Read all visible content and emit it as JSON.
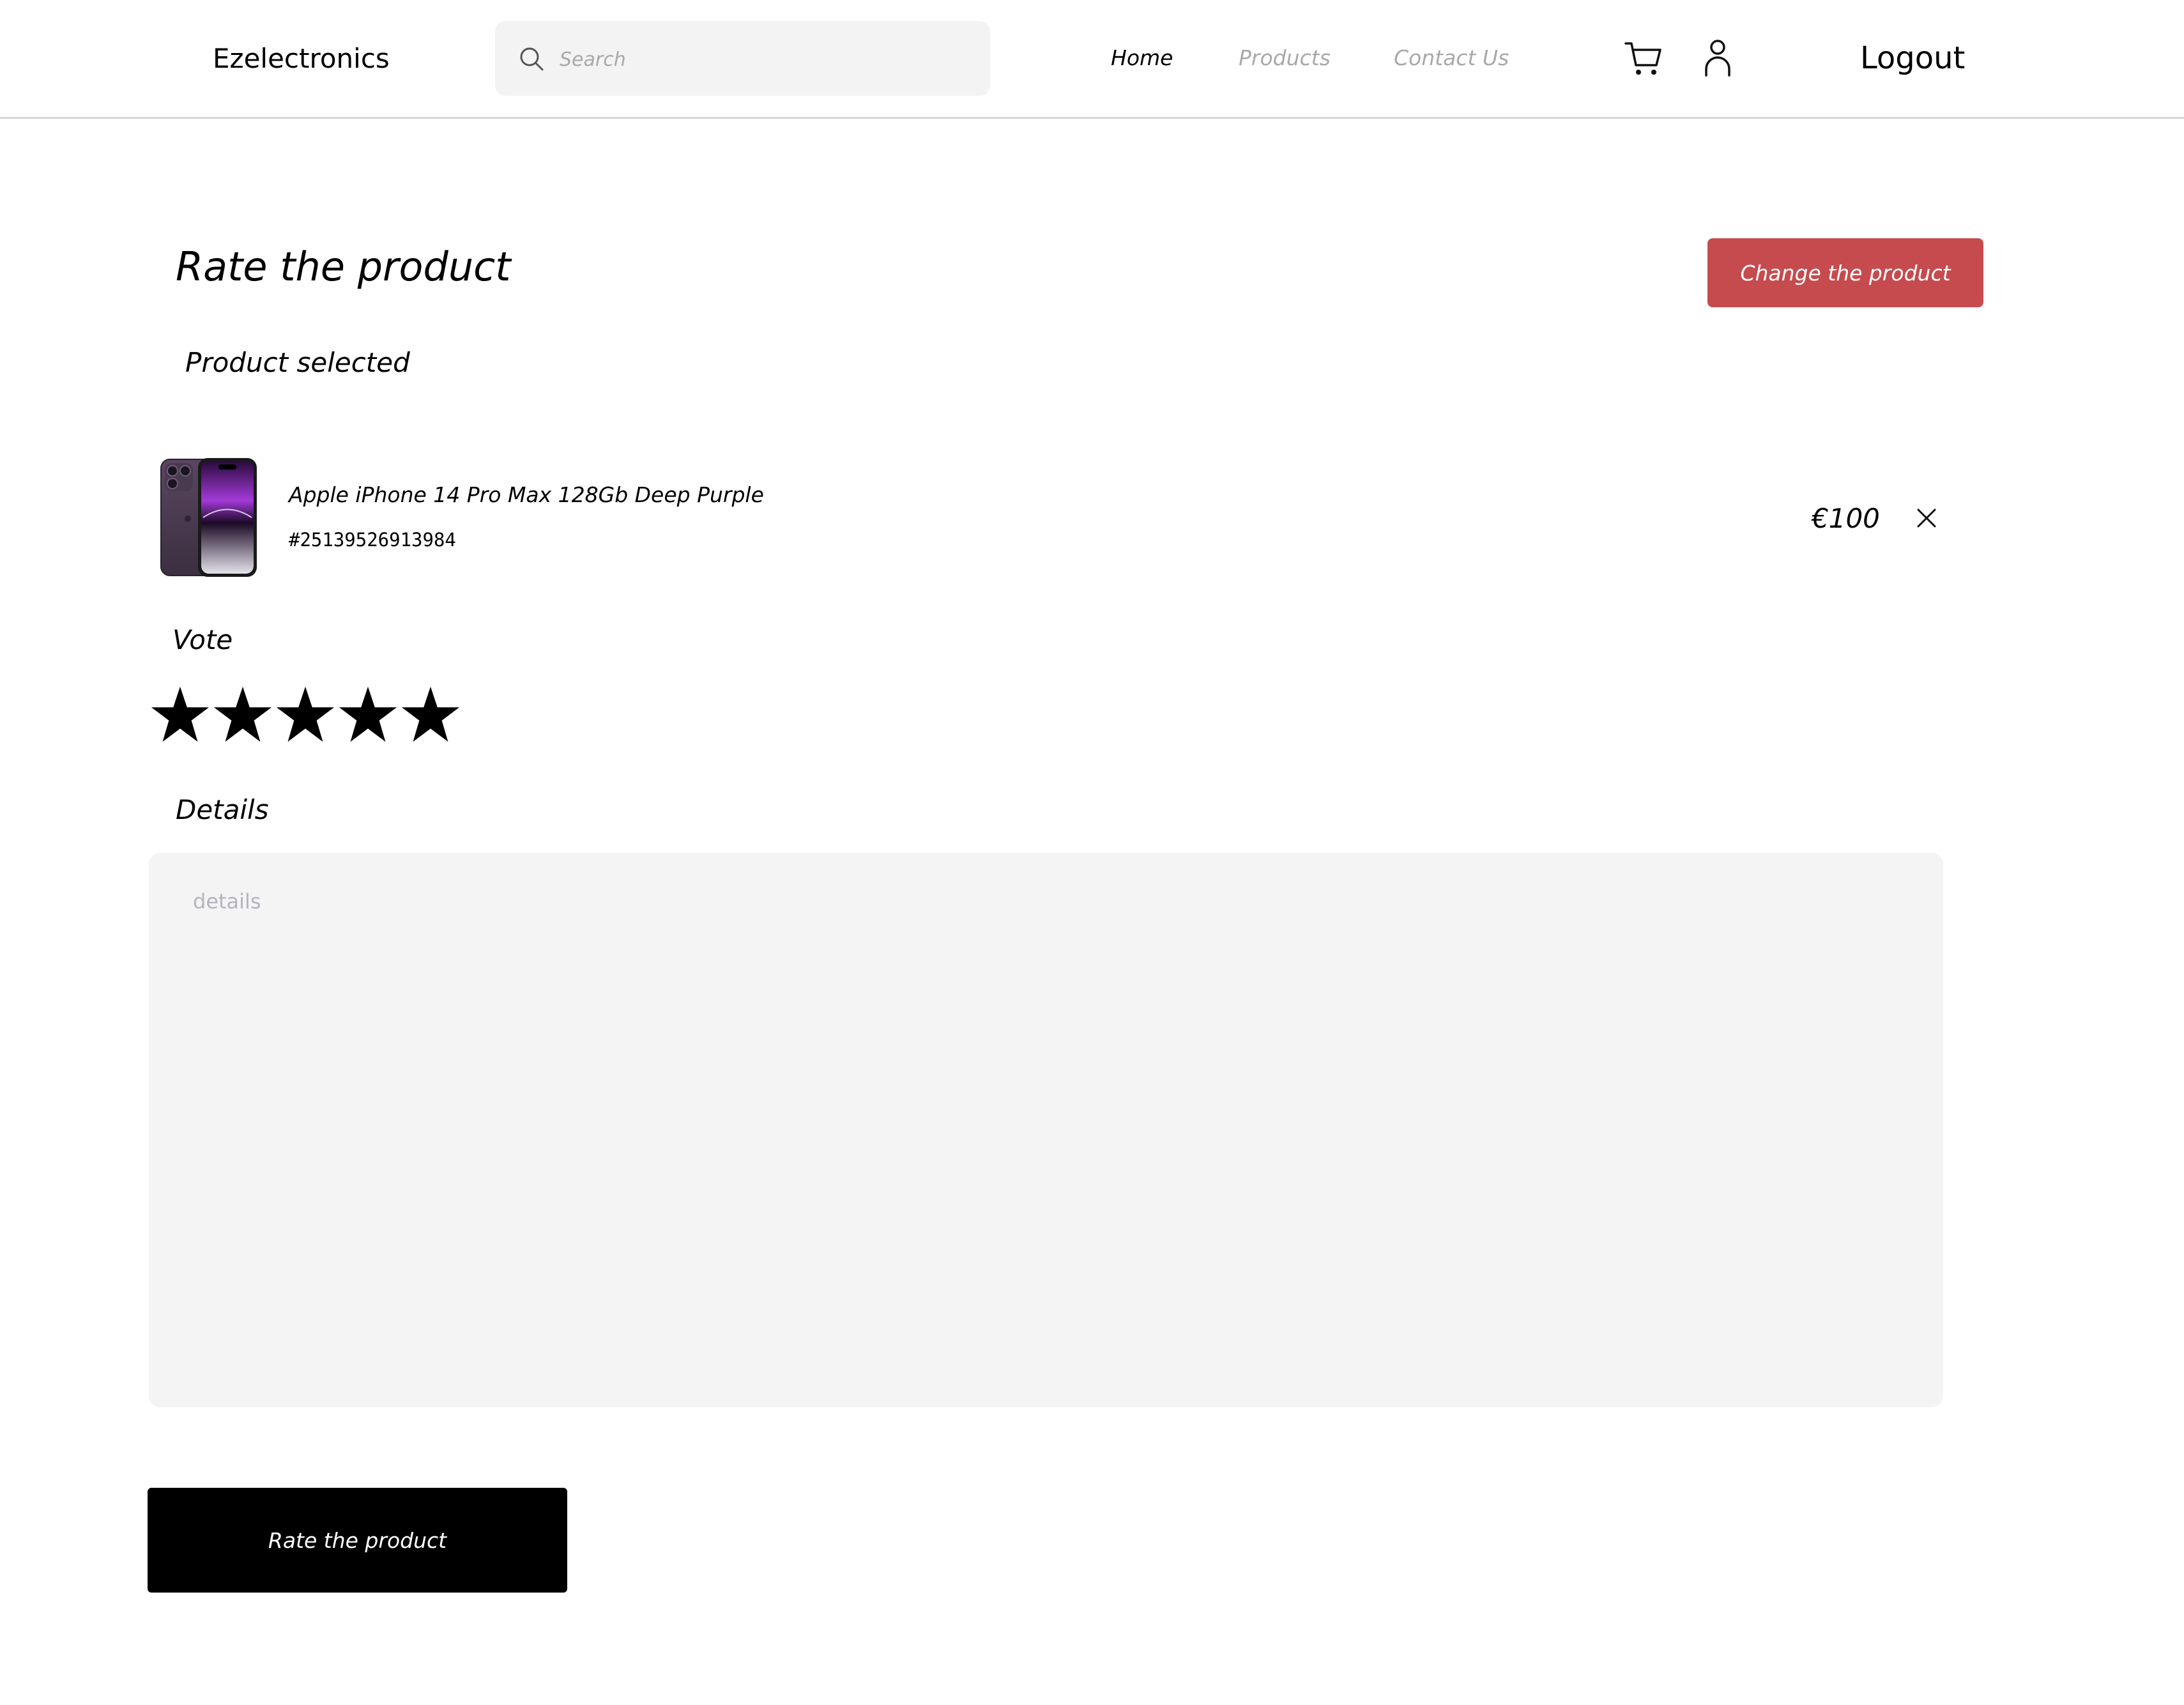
{
  "header": {
    "logo": "Ezelectronics",
    "search_placeholder": "Search",
    "nav": {
      "home": "Home",
      "products": "Products",
      "contact": "Contact Us"
    },
    "cart_icon": "cart-icon",
    "user_icon": "user-icon",
    "logout": "Logout"
  },
  "page": {
    "title": "Rate the product",
    "change_button": "Change the product",
    "product_selected_label": "Product selected"
  },
  "product": {
    "name": "Apple iPhone 14 Pro Max 128Gb Deep Purple",
    "code": "#25139526913984",
    "price": "€100"
  },
  "vote": {
    "label": "Vote",
    "stars_filled": 5,
    "stars_total": 5
  },
  "details": {
    "label": "Details",
    "placeholder": "details"
  },
  "submit_button": "Rate the product",
  "colors": {
    "accent_red": "#c64b4e",
    "button_black": "#000000",
    "muted_text": "#a9a9a9",
    "input_bg": "#f4f4f4"
  }
}
